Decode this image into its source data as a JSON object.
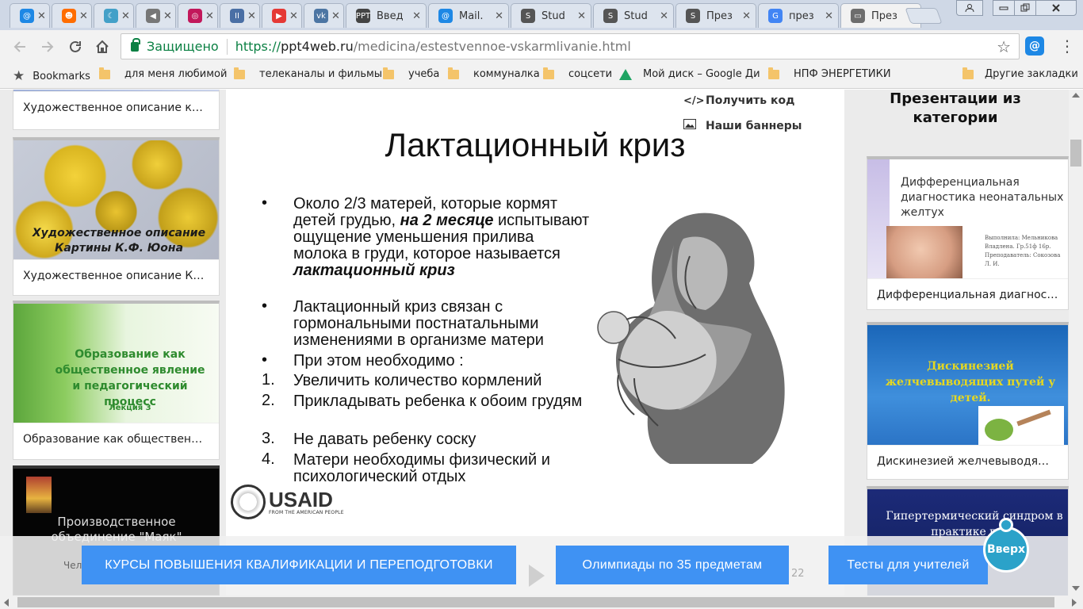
{
  "tabs": [
    {
      "favicon_text": "@",
      "favicon_color": "#1e88e5",
      "label": ""
    },
    {
      "favicon_text": "☻",
      "favicon_color": "#ff6d00",
      "label": ""
    },
    {
      "favicon_text": "☾",
      "favicon_color": "#43a0c8",
      "label": ""
    },
    {
      "favicon_text": "◀",
      "favicon_color": "#777777",
      "label": ""
    },
    {
      "favicon_text": "◎",
      "favicon_color": "#c2185b",
      "label": ""
    },
    {
      "favicon_text": "II",
      "favicon_color": "#4a6fa5",
      "label": ""
    },
    {
      "favicon_text": "▶",
      "favicon_color": "#e53935",
      "label": ""
    },
    {
      "favicon_text": "vk",
      "favicon_color": "#4c75a3",
      "label": ""
    },
    {
      "favicon_text": "PPT",
      "favicon_color": "#444444",
      "label": "Введ"
    },
    {
      "favicon_text": "@",
      "favicon_color": "#1e88e5",
      "label": "Mail."
    },
    {
      "favicon_text": "S",
      "favicon_color": "#555555",
      "label": "Stud"
    },
    {
      "favicon_text": "S",
      "favicon_color": "#555555",
      "label": "Stud"
    },
    {
      "favicon_text": "S",
      "favicon_color": "#555555",
      "label": "През"
    },
    {
      "favicon_text": "G",
      "favicon_color": "#4285f4",
      "label": "през"
    },
    {
      "favicon_text": "▭",
      "favicon_color": "#6d6d6d",
      "label": "През"
    }
  ],
  "url": {
    "secure_label": "Защищено",
    "scheme": "https://",
    "host": "ppt4web.ru",
    "path": "/medicina/estestvennoe-vskarmlivanie.html"
  },
  "bookmarks": {
    "apps_label": "Bookmarks",
    "items": [
      "для меня любимой",
      "телеканалы и фильмы",
      "учеба",
      "коммуналка",
      "соцсети",
      "Мой диск – Google Ди",
      "НПФ ЭНЕРГЕТИКИ"
    ],
    "other_label": "Другие закладки"
  },
  "left_cards": [
    {
      "caption": "Художественное описание карт...",
      "thumb_text": ""
    },
    {
      "caption": "Художественное описание Карт...",
      "thumb_text": "Художественное описание Картины К.Ф. Юона"
    },
    {
      "caption": "Образование как общественное...",
      "thumb_text": "Образование как общественное явление и педагогический процесс",
      "thumb_sub": "Лекция 3"
    },
    {
      "caption": "",
      "thumb_text": "Производственное объединение \"Маяк\""
    }
  ],
  "slide": {
    "title": "Лактационный криз",
    "bullets": [
      {
        "marker": "•",
        "parts": [
          "Около 2/3 матерей, которые кормят детей грудью, ",
          "на 2 месяце",
          " испытывают ощущение уменьшения прилива молока в груди, которое называется ",
          "лактационный криз"
        ]
      },
      {
        "marker": "•",
        "text": "Лактационный криз связан с гормональными постнатальными изменениями в организме матери"
      },
      {
        "marker": "•",
        "text": "При этом необходимо :"
      },
      {
        "marker": "1.",
        "text": "Увеличить количество кормлений"
      },
      {
        "marker": "2.",
        "text": "Прикладывать ребенка к обоим грудям"
      },
      {
        "marker": "3.",
        "text": "Не давать ребенку соску"
      },
      {
        "marker": "4.",
        "text": "Матери необходимы физический и психологический отдых"
      }
    ],
    "logo_text": "USAID",
    "logo_sub": "FROM THE AMERICAN PEOPLE"
  },
  "side_links": {
    "code": "Получить код",
    "banners": "Наши баннеры"
  },
  "right": {
    "title": "Презентации из категории",
    "cards": [
      {
        "caption": "Дифференциальная диагностик...",
        "thumb_title": "Дифференциальная диагностика неонатальных желтух",
        "thumb_meta": "Выполнила: Мельникова Владлена. Гр.51ф 16р. Преподаватель: Сокозова Л. И."
      },
      {
        "caption": "Дискинезией желчевыводящих ...",
        "thumb_title": "Дискинезией желчевыводящих путей у детей."
      },
      {
        "caption": "",
        "thumb_title": "Гипертермический синдром в практике педи"
      }
    ]
  },
  "bottom": {
    "btn1": "КУРСЫ ПОВЫШЕНИЯ КВАЛИФИКАЦИИ И ПЕРЕПОДГОТОВКИ",
    "btn2": "Олимпиады по 35 предметам",
    "btn3": "Тесты для учителей",
    "behind_left": "Чел",
    "behind_page": "22"
  },
  "scroll_top_label": "Вверх"
}
